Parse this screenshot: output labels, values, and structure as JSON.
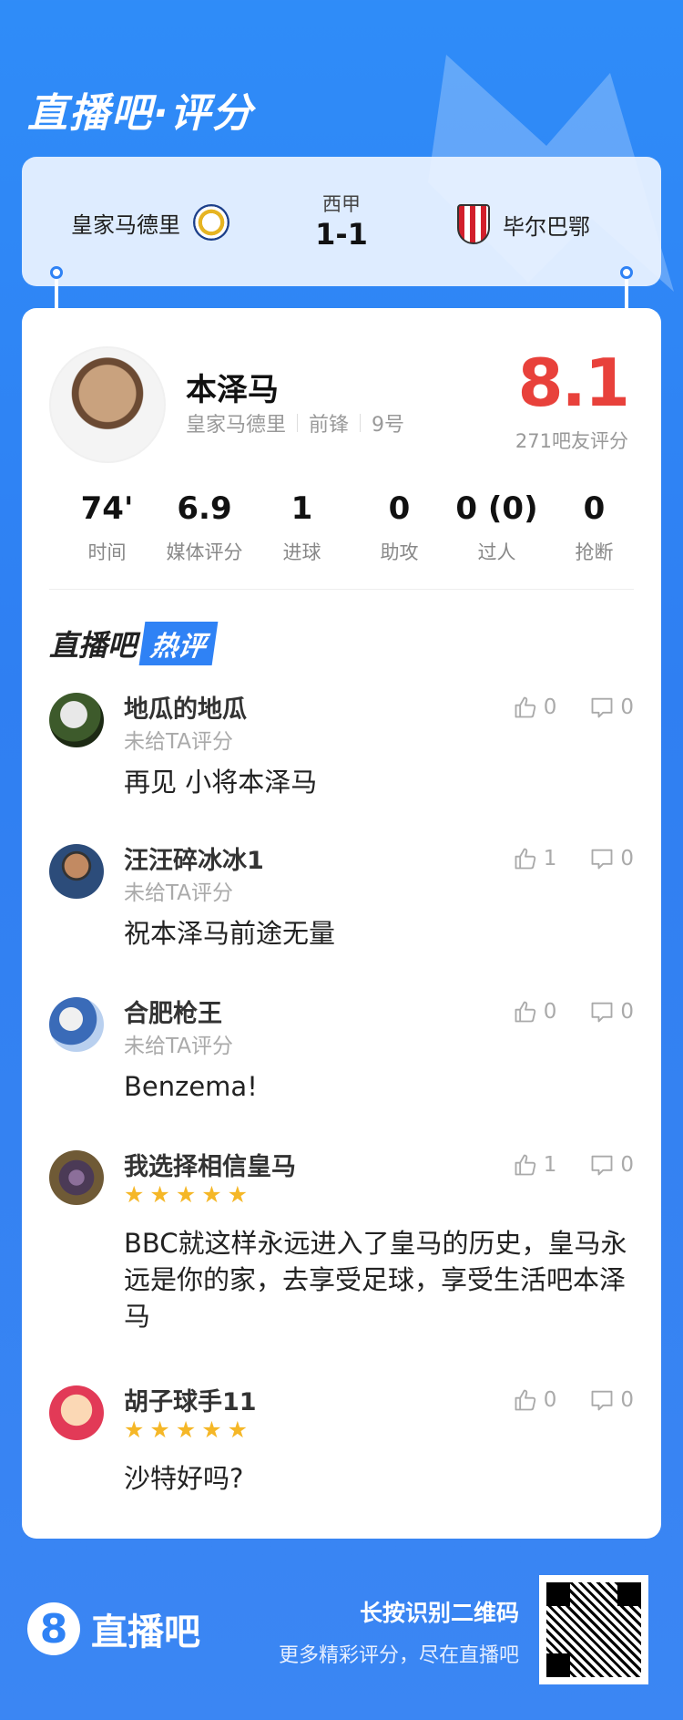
{
  "header": {
    "brand_title": "直播吧·评分"
  },
  "match": {
    "home_team": "皇家马德里",
    "away_team": "毕尔巴鄂",
    "league": "西甲",
    "score": "1-1"
  },
  "player": {
    "name": "本泽马",
    "team": "皇家马德里",
    "position": "前锋",
    "number": "9号",
    "rating": "8.1",
    "rating_count": "271吧友评分"
  },
  "stats": [
    {
      "value": "74'",
      "label": "时间"
    },
    {
      "value": "6.9",
      "label": "媒体评分"
    },
    {
      "value": "1",
      "label": "进球"
    },
    {
      "value": "0",
      "label": "助攻"
    },
    {
      "value": "0 (0)",
      "label": "过人"
    },
    {
      "value": "0",
      "label": "抢断"
    }
  ],
  "hot": {
    "title_part1": "直播吧",
    "title_part2": "热评"
  },
  "comments": [
    {
      "user": "地瓜的地瓜",
      "sub": "未给TA评分",
      "text": "再见 小将本泽马",
      "likes": "0",
      "dislikes": "0"
    },
    {
      "user": "汪汪碎冰冰1",
      "sub": "未给TA评分",
      "text": "祝本泽马前途无量",
      "likes": "1",
      "dislikes": "0"
    },
    {
      "user": "合肥枪王",
      "sub": "未给TA评分",
      "text": "Benzema!",
      "likes": "0",
      "dislikes": "0"
    },
    {
      "user": "我选择相信皇马",
      "stars": "★★★★★",
      "text": "BBC就这样永远进入了皇马的历史，皇马永远是你的家，去享受足球，享受生活吧本泽马",
      "likes": "1",
      "dislikes": "0"
    },
    {
      "user": "胡子球手11",
      "stars": "★★★★★",
      "text": "沙特好吗?",
      "likes": "0",
      "dislikes": "0"
    }
  ],
  "footer": {
    "logo_mark": "8",
    "logo_text": "直播吧",
    "cta_main": "长按识别二维码",
    "cta_sub": "更多精彩评分，尽在直播吧"
  },
  "colors": {
    "brand_blue": "#2f82f5",
    "rating_red": "#e8413b",
    "star_gold": "#f5b727"
  }
}
